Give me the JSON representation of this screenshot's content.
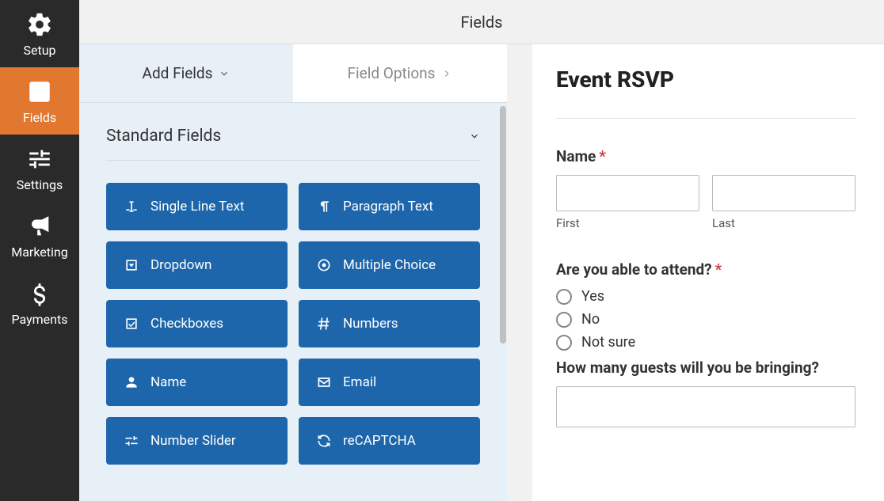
{
  "nav": {
    "items": [
      {
        "label": "Setup",
        "icon": "gear"
      },
      {
        "label": "Fields",
        "icon": "form"
      },
      {
        "label": "Settings",
        "icon": "sliders"
      },
      {
        "label": "Marketing",
        "icon": "megaphone"
      },
      {
        "label": "Payments",
        "icon": "dollar"
      }
    ],
    "active_index": 1
  },
  "header": {
    "title": "Fields"
  },
  "tabs": {
    "add_fields": "Add Fields",
    "field_options": "Field Options",
    "active": "add_fields"
  },
  "section": {
    "title": "Standard Fields"
  },
  "field_buttons": [
    {
      "label": "Single Line Text",
      "icon": "text-cursor"
    },
    {
      "label": "Paragraph Text",
      "icon": "paragraph"
    },
    {
      "label": "Dropdown",
      "icon": "caret-square"
    },
    {
      "label": "Multiple Choice",
      "icon": "radio-dot"
    },
    {
      "label": "Checkboxes",
      "icon": "check-square"
    },
    {
      "label": "Numbers",
      "icon": "hash"
    },
    {
      "label": "Name",
      "icon": "user"
    },
    {
      "label": "Email",
      "icon": "envelope"
    },
    {
      "label": "Number Slider",
      "icon": "sliders-h"
    },
    {
      "label": "reCAPTCHA",
      "icon": "recaptcha"
    }
  ],
  "preview": {
    "form_title": "Event RSVP",
    "name": {
      "label": "Name",
      "required": true,
      "first_sublabel": "First",
      "last_sublabel": "Last"
    },
    "attend": {
      "label": "Are you able to attend?",
      "required": true,
      "options": [
        "Yes",
        "No",
        "Not sure"
      ]
    },
    "guests": {
      "label": "How many guests will you be bringing?"
    }
  }
}
